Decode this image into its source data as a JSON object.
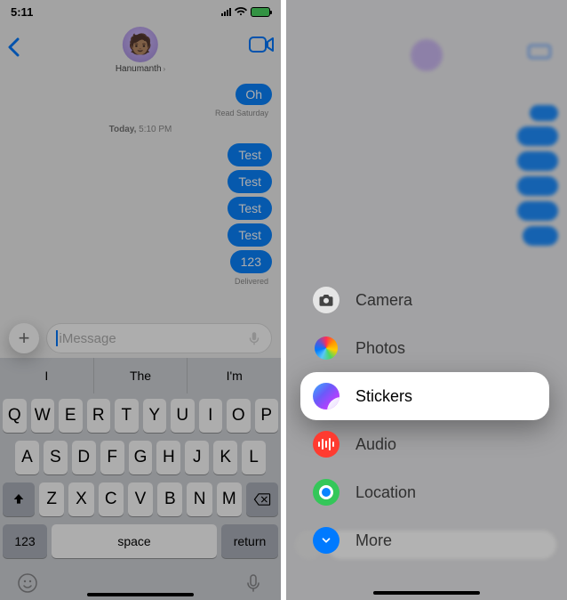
{
  "left": {
    "statusbar": {
      "time": "5:11"
    },
    "nav": {
      "contact_name": "Hanumanth"
    },
    "messages": {
      "m1": "Oh",
      "m1_status": "Read Saturday",
      "separator": "Today, 5:10 PM",
      "t1": "Test",
      "t2": "Test",
      "t3": "Test",
      "t4": "Test",
      "t5": "123",
      "delivered": "Delivered"
    },
    "compose": {
      "placeholder": "iMessage"
    },
    "suggestions": {
      "s1": "I",
      "s2": "The",
      "s3": "I'm"
    },
    "keyboard": {
      "r1": [
        "Q",
        "W",
        "E",
        "R",
        "T",
        "Y",
        "U",
        "I",
        "O",
        "P"
      ],
      "r2": [
        "A",
        "S",
        "D",
        "F",
        "G",
        "H",
        "J",
        "K",
        "L"
      ],
      "r3": [
        "Z",
        "X",
        "C",
        "V",
        "B",
        "N",
        "M"
      ],
      "num": "123",
      "space": "space",
      "ret": "return"
    }
  },
  "right": {
    "menu": {
      "camera": "Camera",
      "photos": "Photos",
      "stickers": "Stickers",
      "audio": "Audio",
      "location": "Location",
      "more": "More"
    }
  }
}
